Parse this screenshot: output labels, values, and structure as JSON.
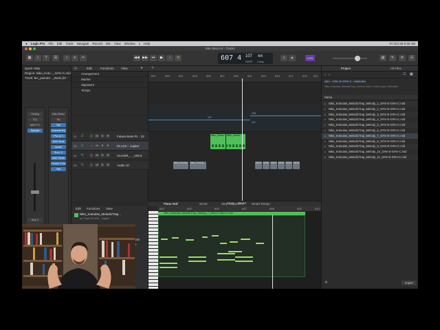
{
  "menubar": {
    "apple": "",
    "app": "Logic Pro",
    "items": [
      "File",
      "Edit",
      "Track",
      "Navigate",
      "Record",
      "Mix",
      "View",
      "Window",
      "1",
      "Help"
    ],
    "clock": "Fri Oct 29  9:40 AM"
  },
  "window": {
    "title": "Niko Beat A4 - Tracks"
  },
  "lcd": {
    "position": "607 4",
    "tempo": "107",
    "tempo_label": "KEEP",
    "signature": "4/4",
    "key": "Cmaj"
  },
  "controls": {
    "transport": [
      "◀◀",
      "▶▶",
      "⏮",
      "▶",
      "●",
      "⟲"
    ],
    "cpu_label": "1234"
  },
  "inspector": {
    "quick_help": "Quick Help",
    "region_label": "Region:",
    "region_value": "Niko_Koto..._G#m-C.mid",
    "track_label": "Track:",
    "track_value": "BA_pseudo..._Bass [Di",
    "strip_left": [
      "Setting",
      "EQ",
      "MIDI FX",
      "Sample"
    ],
    "strip_right": [
      "Niko Basic",
      "Ra",
      "Sat",
      "Channel EQ",
      "Pro-Q 3",
      "SAD Dust",
      "ozone",
      "Pro-L 2",
      "SAD Fetch",
      "Ozone 9 Im",
      "Sat"
    ],
    "bus_a": "Bus 2",
    "bus_b": "Bus 1",
    "stereo_out": "Stereo Out",
    "read_a": "Read",
    "read_b": "Read",
    "mode_a": "M S",
    "mode_b": "M S"
  },
  "tracks_toolbar": {
    "edit": "Edit",
    "functions": "Functions",
    "view": "View"
  },
  "global_tracks": [
    "Arrangement",
    "Marker",
    "Signature",
    "Tempo"
  ],
  "tracks": [
    {
      "num": "22",
      "name": "Future Bass PL - 22"
    },
    {
      "num": "23",
      "name": "PLUCK - Jupiter"
    },
    {
      "num": "24",
      "name": "OLIVER_..._106.9"
    },
    {
      "num": "25",
      "name": "Audio 10"
    }
  ],
  "ruler_bars": [
    "597",
    "599",
    "601",
    "603",
    "605",
    "607",
    "609",
    "611",
    "613",
    "615",
    "617",
    "619",
    "621"
  ],
  "regions": {
    "green_a": "Niko_Kotoul...",
    "green_b": "Niko_Kotoul...",
    "grey_a": "Niko_Drums",
    "grey_b": "Niko_Drums",
    "grey_c": "NEW",
    "grey_d": "NEW",
    "grey_e": "NEW",
    "grey_f": "NEW",
    "grey_g": "NEW",
    "grey_h": "NEW"
  },
  "tempo_marks": [
    "107",
    "108",
    "112"
  ],
  "editor": {
    "tabs": [
      "Piano Roll",
      "Score",
      "Step Sequencer",
      "Smart Tempo"
    ],
    "toolbar": {
      "edit": "Edit",
      "functions": "Functions",
      "view": "View",
      "snap": "Snap:",
      "snap_value": "Smart"
    },
    "region_name": "Niko_Kotoulas_MelodicTrap...",
    "region_track": "on Track PLUCK - Jupiter",
    "region_bar": "Niko_Kotoulas_MelodicTrap_Melody_7_G#m-E-G#m-C.mid",
    "time_quantize": "Time Quantize (classic)",
    "quantize_value": "1/16 Note",
    "strength_label": "Strength",
    "strength_value": "100",
    "swing_label": "Swing",
    "swing_value": "0",
    "scale_quantize": "Scale Quantize",
    "scale_off": "Off",
    "scale_root": "C",
    "scale_mode": "Major",
    "ruler": [
      "604",
      "605",
      "606",
      "607",
      "608",
      "609",
      "610"
    ]
  },
  "browser": {
    "tab_project": "Project",
    "tab_all": "All Files",
    "path": [
      "niko",
      "G#m-E-G#m-C",
      "Melodies"
    ],
    "path_full": "Niko_Kotoulas_MelodicTrap_G#m-E-G#m-C.midi Loops / Melodies",
    "column": "Name",
    "files": [
      "Niko_Kotoulas_MelodicTrap_Melody_1_G#m-E-G#m-C.mid",
      "Niko_Kotoulas_MelodicTrap_Melody_2_G#m-E-G#m-C.mid",
      "Niko_Kotoulas_MelodicTrap_Melody_3_G#m-E-G#m-C.mid",
      "Niko_Kotoulas_MelodicTrap_Melody_4_G#m-E-G#m-C.mid",
      "Niko_Kotoulas_MelodicTrap_Melody_5_G#m-E-G#m-C.mid",
      "Niko_Kotoulas_MelodicTrap_Melody_6_G#m-E-G#m-C.mid",
      "Niko_Kotoulas_MelodicTrap_Melody_7_G#m-E-G#m-C.mid",
      "Niko_Kotoulas_MelodicTrap_Melody_8_G#m-E-G#m-C.mid",
      "Niko_Kotoulas_MelodicTrap_Melody_9_G#m-E-G#m-C.mid",
      "Niko_Kotoulas_MelodicTrap_Melody_10_G#m-E-G#m-C.mid",
      "Niko_Kotoulas_MelodicTrap_Melody_11_G#m-E-G#m-C.mid"
    ],
    "import": "Import"
  }
}
